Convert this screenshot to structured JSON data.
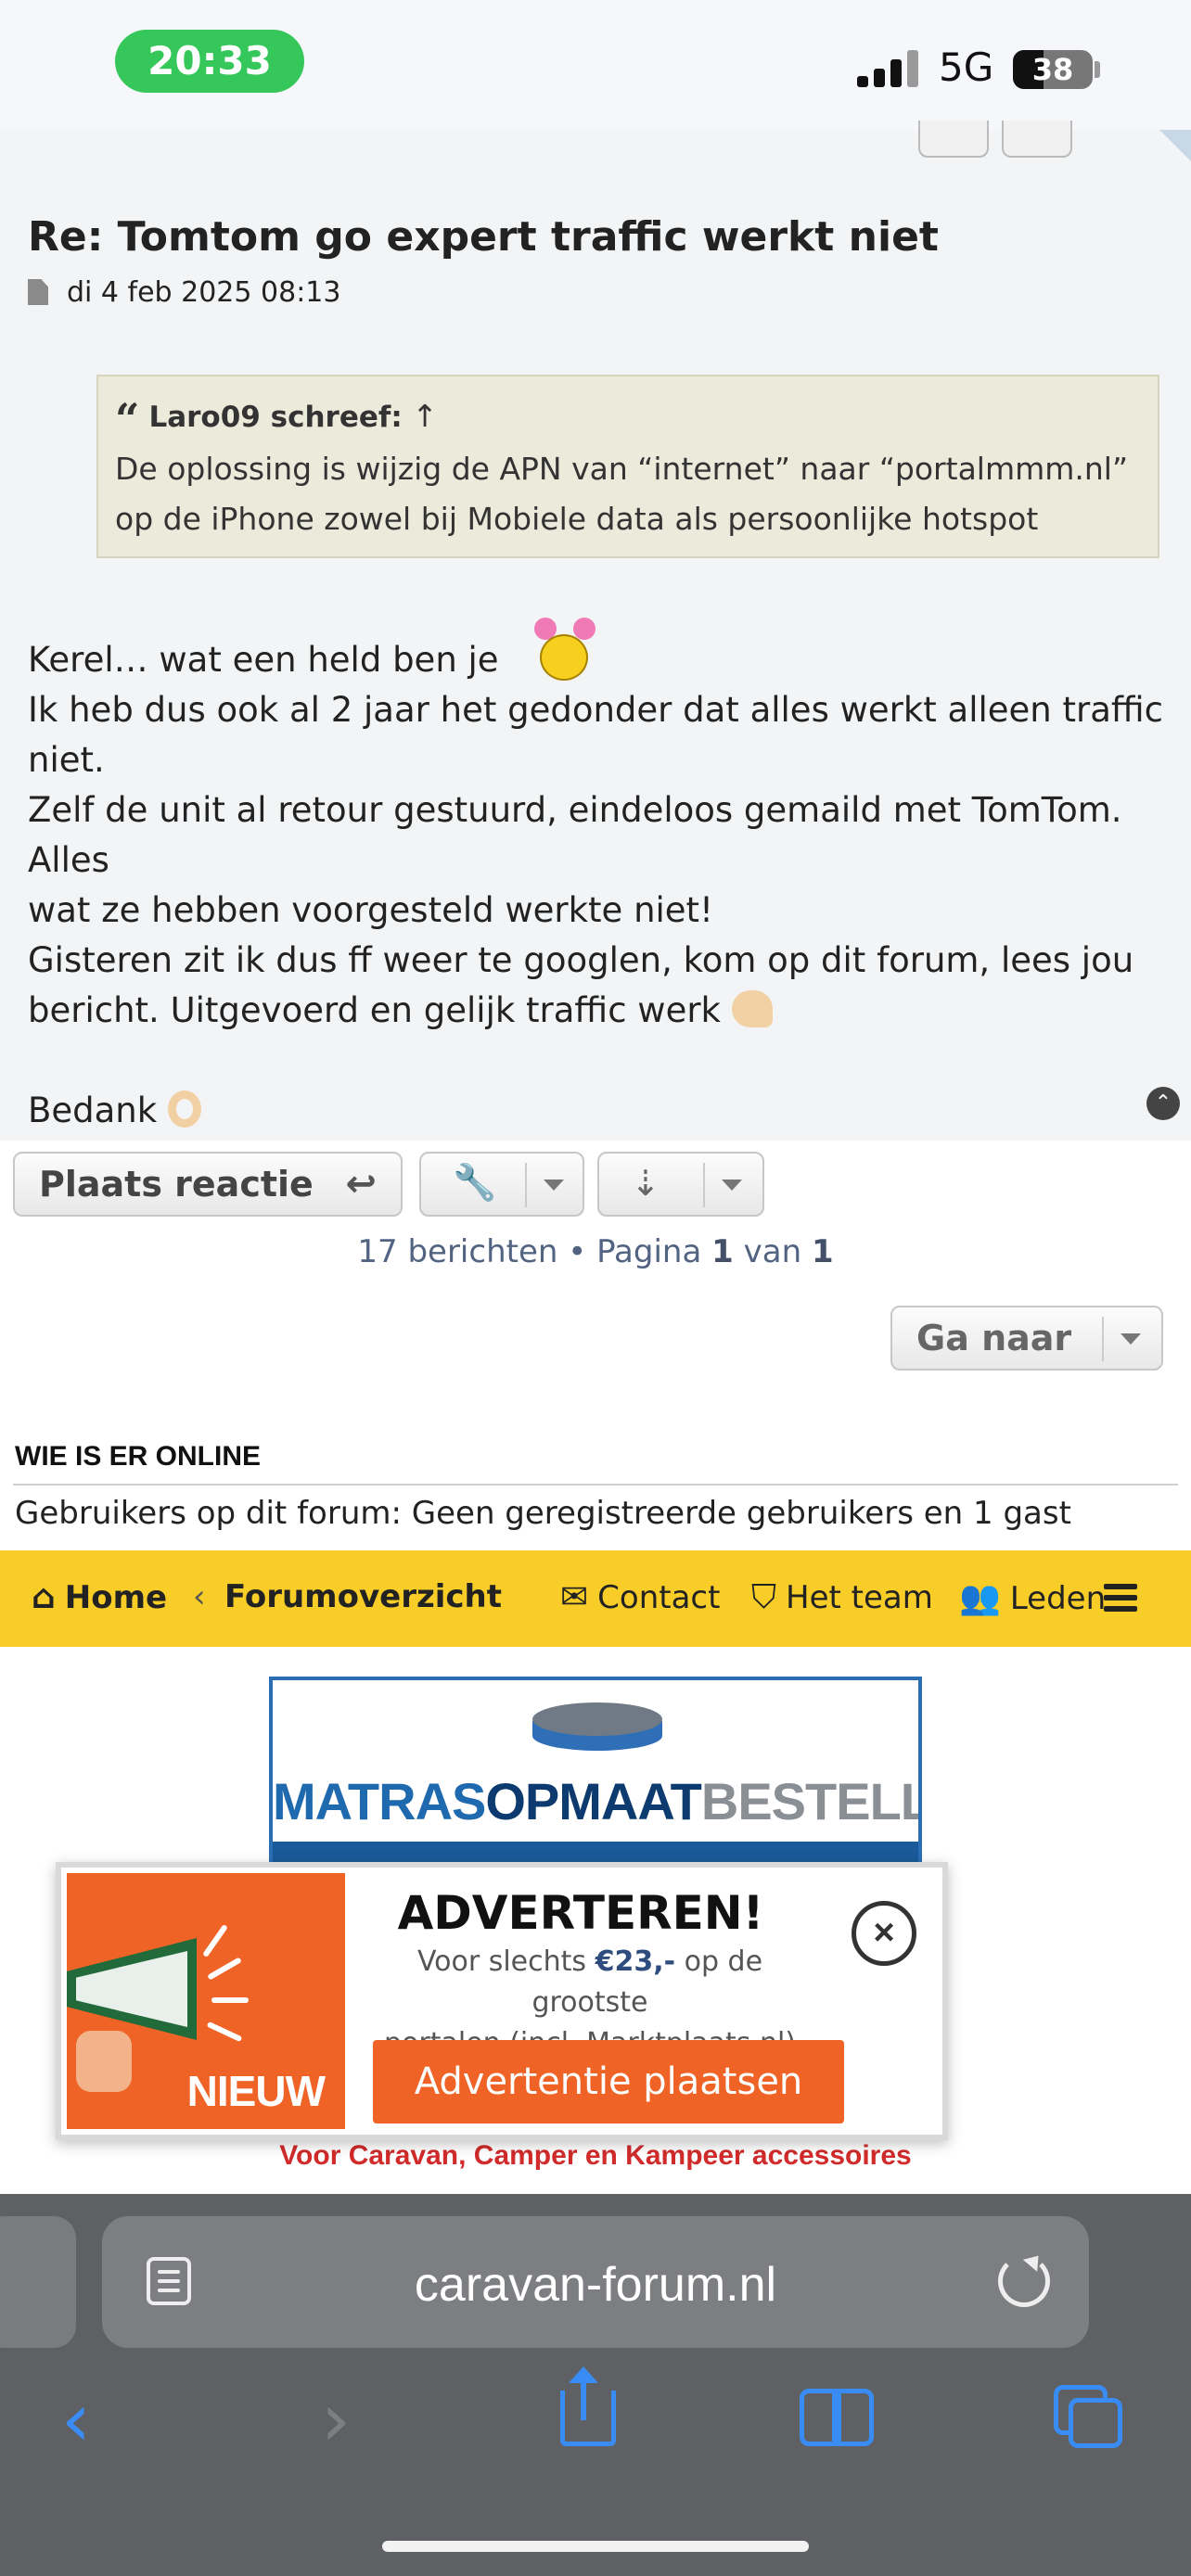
{
  "status": {
    "time": "20:33",
    "network": "5G",
    "battery": "38",
    "battery_level": 0.38
  },
  "post": {
    "title": "Re: Tomtom go expert traffic werkt niet",
    "date": "di 4 feb 2025 08:13",
    "quote": {
      "author": "Laro09 schreef:",
      "arrow": "↑",
      "line1": "De oplossing is wijzig de APN van “internet” naar “portalmmm.nl”",
      "line2": "op de iPhone zowel bij Mobiele data als persoonlijke hotspot"
    },
    "body": {
      "line1": "Kerel… wat een held ben je",
      "line2": "Ik heb dus ook al 2 jaar het gedonder dat alles werkt alleen traffic",
      "line3": "niet.",
      "line4": "Zelf de unit al retour gestuurd, eindeloos gemaild met TomTom. Alles",
      "line5": "wat ze hebben voorgesteld werkte niet!",
      "line6": "Gisteren zit ik dus ff weer te googlen, kom op dit forum, lees jou",
      "line7": "bericht. Uitgevoerd en gelijk traffic werk",
      "line8": "Bedank"
    }
  },
  "actions": {
    "reply_label": "Plaats reactie",
    "pagination_prefix": "17 berichten • Pagina",
    "page_current": "1",
    "pagination_mid": "van",
    "page_total": "1",
    "goto_label": "Ga naar"
  },
  "online": {
    "title": "WIE IS ER ONLINE",
    "text": "Gebruikers op dit forum: Geen geregistreerde gebruikers en 1 gast"
  },
  "nav": {
    "home": "Home",
    "separator": "‹",
    "forum": "Forumoverzicht",
    "contact": "Contact",
    "team": "Het team",
    "members": "Leden"
  },
  "banner": {
    "logo_part1": "MATRAS",
    "logo_part2": "OPMAAT",
    "logo_part3": "BESTELLEN.NL",
    "tagline": "Voor Caravan, Camper en Kampeer accessoires"
  },
  "ad": {
    "badge": "NIEUW",
    "title": "ADVERTEREN!",
    "desc_prefix": "Voor slechts",
    "desc_price": "€23,-",
    "desc_suffix": "op de grootste",
    "desc_line2": "portalen (incl. Marktplaats.nl)",
    "cta": "Advertentie plaatsen",
    "close": "×"
  },
  "browser": {
    "url": "caravan-forum.nl"
  },
  "colors": {
    "nav_bg": "#f8cd28",
    "ad_orange": "#ef6426",
    "link_blue": "#3a8cf5",
    "time_green": "#35c759"
  }
}
